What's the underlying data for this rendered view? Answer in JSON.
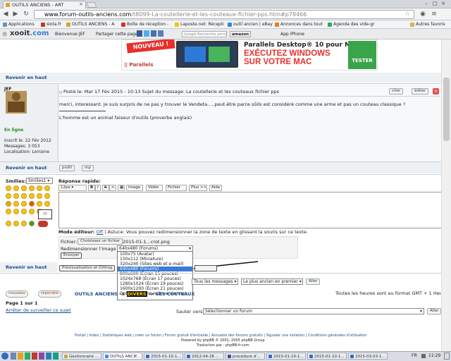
{
  "browser": {
    "tab_title": "OUTILS ANCIENS - ART",
    "url_host": "www.forum-outils-anciens.com",
    "url_path": "/t8099-La-coutellerie-et-les-couteaux-fichier-pps.htm#p78466",
    "bookmarks": [
      "Applications",
      "slota.fr",
      "OUTILS ANCIENS - A",
      "Boîte de réception -",
      "Laposte.net: Récepti",
      "outil ancien | eBay",
      "Annonces dans tout",
      "Agenda des vide-gr"
    ],
    "other_bookmarks": "Autres favoris"
  },
  "xooit": {
    "logo_a": "xooit",
    "logo_b": ".com",
    "welcome": "Bienvenue JEF",
    "share": "Partager cette page",
    "search_placeholder": "Google Recherche personnalisée",
    "amazon": "amazon",
    "app": "App iPhone"
  },
  "ad": {
    "badge": "NOUVEAU !",
    "title": "Parallels Desktop® 10 pour Mac",
    "line1": "EXÉCUTEZ WINDOWS",
    "line2": "SUR VOTRE MAC",
    "button": "TESTER",
    "logo": "|| Parallels"
  },
  "revenir": "Revenir en haut",
  "post": {
    "author": "JEF",
    "status": "En ligne",
    "inscrit": "Inscrit le: 22 Fév 2012",
    "messages": "Messages: 3 053",
    "localisation": "Localisation: Lorraine",
    "header": "Posté le: Mar 17 Fév 2015 - 10:13    Sujet du message: La coutellerie et les couteaux fichier pps",
    "body": "merci, interessant. Je suis surpris de ne pas y trouver le Vendeta.....peut-être parce sûils est considéré comme une arme et pas un couteau classique ?",
    "signature": "L'homme est un animal faiseur d'outils (proverbe anglais)",
    "quote_btn": "citer",
    "edit_btn": "éditer",
    "profile_btn": "profil",
    "mp_btn": "mp"
  },
  "reply": {
    "smilies_label": "Smilies:",
    "smilies_select": "Smilies1",
    "title": "Réponse rapide:",
    "toolbar": {
      "size": "12px",
      "b": "B",
      "i": "I",
      "s": "S",
      "image": "Image",
      "video": "Vidéo",
      "fichier": "Fichier",
      "plus": "Plus >>",
      "aide": "Aide"
    },
    "mode_label": "Mode éditeur:",
    "mode_value": "Off",
    "mode_tip": " | Astuce: Vous pouvez redimensionner la zone de texte en glissant la souris sur ce texte.",
    "fichier_label": "Fichier:",
    "choose_btn": "Choisissez un fichier",
    "filename": "2015-01-1...crot.png",
    "resize_label": "Redimensionner l'image ?",
    "resize_value": "640x480 (Forums)",
    "envoyer": "Envoyer",
    "preview_btn": "Prévisualisation et Orthog",
    "options": [
      "100x75 (Avatar)",
      "150x112 (Miniature)",
      "320x240 (Sites web et e-mail)",
      "640x480 (Forums)",
      "800x600 (Écran 15 pouces)",
      "1024x768 (Écran 17 pouces)",
      "1280x1024 (Écran 19 pouces)",
      "1600x1200 (Écran 21 pouces)",
      "Optimiser sans redimensionner"
    ]
  },
  "nav": {
    "sort1": "Tous les messages",
    "sort2": "Le plus ancien en premier",
    "aller": "Aller",
    "nouveau": "nouveau",
    "repondre": "répondre",
    "crumb_a": "OUTILS ANCIENS",
    "crumb_b": "DIVERS",
    "crumb_c": "LES COUTEAUX",
    "timezone": "Toutes les heures sont au format GMT + 1 Heure",
    "page": "Page 1 sur 1",
    "watch": "Arrêter de surveiller ce sujet",
    "jump_label": "Sauter vers:",
    "jump_value": "Sélectionner un forum",
    "jump_btn": "Aller"
  },
  "footer": {
    "links": "Portail | Index | Statistiques web | créer un forum | Forum gratuit d'entraide | Annuaire des forums gratuits | Signaler une violation | Conditions générales d'utilisation",
    "powered": "Powered by phpBB © 2001, 2005 phpBB Group",
    "trad": "Traduction par : phpBB-fr.com"
  },
  "taskbar": {
    "items": [
      "Gestionnaire ...",
      "OUTILS ANCIE...",
      "2015-01-10-1...",
      "2012-04-26 ...",
      "procédure d'...",
      "2015-01-10-1...",
      "2015-01-10-1...",
      "2015-03-03-1..."
    ],
    "lang": "FR",
    "time": "11:29"
  }
}
